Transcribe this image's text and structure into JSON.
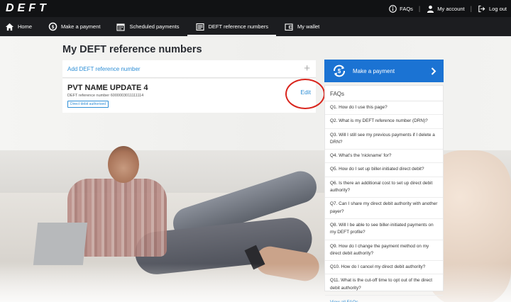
{
  "app": {
    "logo": "DEFT"
  },
  "topbar": {
    "faqs_label": "FAQs",
    "account_label": "My account",
    "logout_label": "Log out"
  },
  "nav": {
    "items": [
      {
        "label": "Home",
        "icon": "home-icon"
      },
      {
        "label": "Make a payment",
        "icon": "payment-cycle-icon"
      },
      {
        "label": "Scheduled payments",
        "icon": "calendar-icon"
      },
      {
        "label": "DEFT reference numbers",
        "icon": "document-icon",
        "active": true
      },
      {
        "label": "My wallet",
        "icon": "wallet-icon"
      }
    ]
  },
  "page": {
    "title": "My DEFT reference numbers"
  },
  "references": {
    "add_label": "Add DEFT reference number",
    "add_icon": "plus-icon",
    "item": {
      "name": "PVT NAME UPDATE 4",
      "drn_text": "DEFT reference number 6000003011111114",
      "badge": "Direct debit authorised",
      "edit_label": "Edit"
    }
  },
  "sidebar": {
    "pay_button_label": "Make a payment",
    "faq_title": "FAQs",
    "faqs": [
      "Q1. How do I use this page?",
      "Q2. What is my DEFT reference number (DRN)?",
      "Q3. Will I still see my previous payments if I delete a DRN?",
      "Q4. What's the 'nickname' for?",
      "Q5. How do I set up biller-initiated direct debit?",
      "Q6. Is there an additional cost to set up direct debit authority?",
      "Q7. Can I share my direct debit authority with another payer?",
      "Q8. Will I be able to see biller-initiated payments on my DEFT profile?",
      "Q9. How do I change the payment method on my direct debit authority?",
      "Q10. How do I cancel my direct debit authority?",
      "Q11. What is the cut-off time to opt out of the direct debit authority?"
    ],
    "view_all_label": "View all FAQs"
  },
  "colors": {
    "accent": "#1b73d3",
    "link": "#2f8fd6",
    "topbar": "#111214",
    "navbar": "#1c1d20",
    "annotation": "#d9251d"
  }
}
